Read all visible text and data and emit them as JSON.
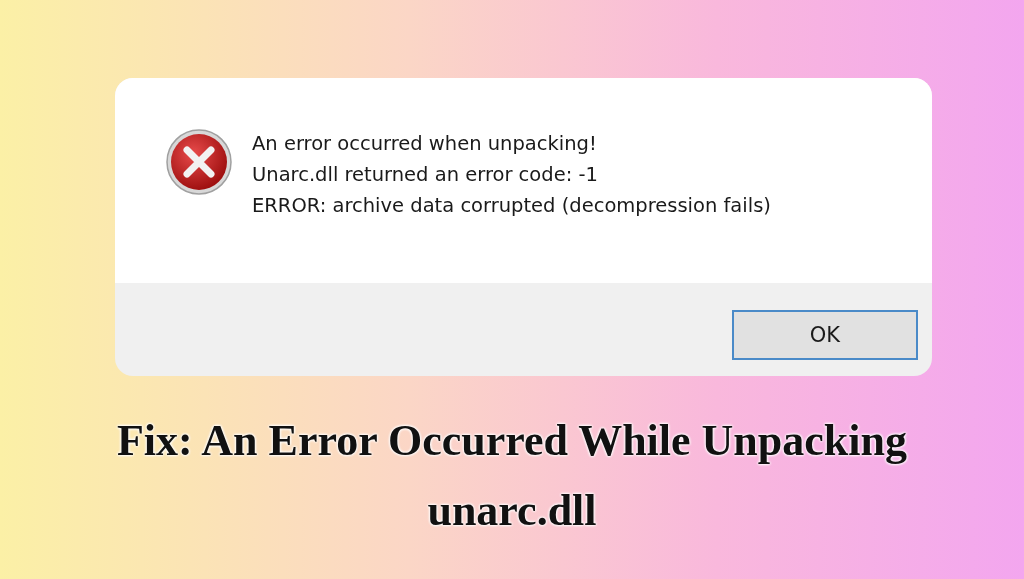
{
  "dialog": {
    "message_lines": [
      "An error occurred when unpacking!",
      "Unarc.dll returned an error code: -1",
      "ERROR: archive data corrupted (decompression fails)"
    ],
    "buttons": [
      {
        "label": "OK",
        "selected": true
      }
    ]
  },
  "headline": [
    "Fix: An Error Occurred While Unpacking",
    "unarc.dll"
  ]
}
